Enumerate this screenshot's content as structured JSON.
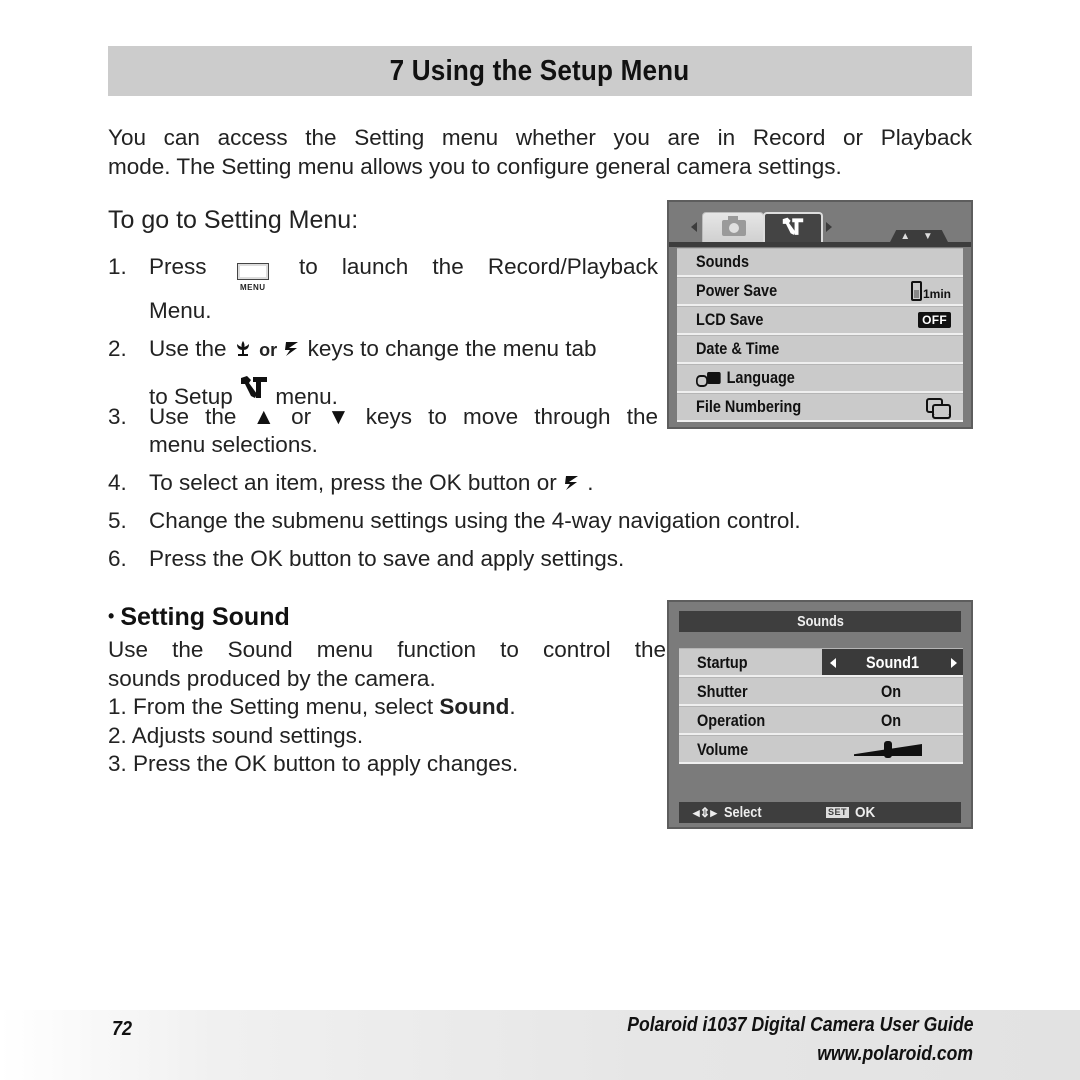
{
  "page": {
    "title": "7 Using the Setup Menu",
    "intro_lines": [
      "You can access the Setting menu whether you are in Record or Playback",
      "mode. The Setting menu allows you to configure general camera settings."
    ]
  },
  "goto": {
    "heading": "To go to Setting Menu:",
    "steps": [
      {
        "num": "1.",
        "pre": "Press",
        "icon": "menu-button-icon",
        "icon_label": "MENU",
        "post": "to launch the Record/Playback",
        "cont": "Menu."
      },
      {
        "num": "2.",
        "pre": "Use the",
        "icon1": "macro-key-icon",
        "or": "or",
        "icon2": "flash-key-icon",
        "post": "keys to change the menu tab",
        "cont_pre": "to Setup",
        "cont_icon": "setup-tools-icon",
        "cont_post": "menu."
      },
      {
        "num": "3.",
        "pre": "Use the",
        "icon1": "▲",
        "or": "or",
        "icon2": "▼",
        "post": "keys to move through the",
        "cont": "menu selections."
      },
      {
        "num": "4.",
        "text": "To select an item, press the OK button or",
        "icon": "flash-key-icon",
        "end": "."
      },
      {
        "num": "5.",
        "text": "Change the submenu settings using the 4-way navigation control."
      },
      {
        "num": "6.",
        "text": "Press the OK button to save and apply settings."
      }
    ]
  },
  "setup_screen": {
    "tabs": [
      {
        "name": "camera",
        "icon": "camera-icon",
        "active": false
      },
      {
        "name": "setup",
        "icon": "setup-tools-icon",
        "active": true
      }
    ],
    "scroll_indicator": "▲ ▼",
    "items": [
      {
        "label": "Sounds",
        "value_type": "none"
      },
      {
        "label": "Power Save",
        "value_type": "battery",
        "value": "1min"
      },
      {
        "label": "LCD Save",
        "value_type": "badge",
        "value": "OFF"
      },
      {
        "label": "Date & Time",
        "value_type": "none"
      },
      {
        "label": "Language",
        "value_type": "none",
        "prefix_icon": "language-icon"
      },
      {
        "label": "File Numbering",
        "value_type": "icon",
        "value_icon": "file-numbering-icon"
      }
    ]
  },
  "sound_section": {
    "heading": "Setting Sound",
    "bullet": "•",
    "body_lines": [
      "Use the Sound menu function to control the",
      "sounds produced by the camera."
    ],
    "steps": [
      {
        "pre": "1. From the Setting menu, select ",
        "bold": "Sound",
        "post": "."
      },
      {
        "text": "2. Adjusts sound settings."
      },
      {
        "text": "3. Press the OK button to apply changes."
      }
    ]
  },
  "sounds_screen": {
    "title": "Sounds",
    "items": [
      {
        "label": "Startup",
        "value": "Sound1",
        "selected": true
      },
      {
        "label": "Shutter",
        "value": "On"
      },
      {
        "label": "Operation",
        "value": "On"
      },
      {
        "label": "Volume",
        "value_type": "slider",
        "level": 0.5
      }
    ],
    "footer": {
      "nav_icon": "◂⇕▸",
      "select_label": "Select",
      "set_icon": "SET",
      "ok_label": "OK"
    }
  },
  "footer": {
    "page_number": "72",
    "guide_title": "Polaroid i1037 Digital Camera User Guide",
    "url": "www.polaroid.com"
  }
}
